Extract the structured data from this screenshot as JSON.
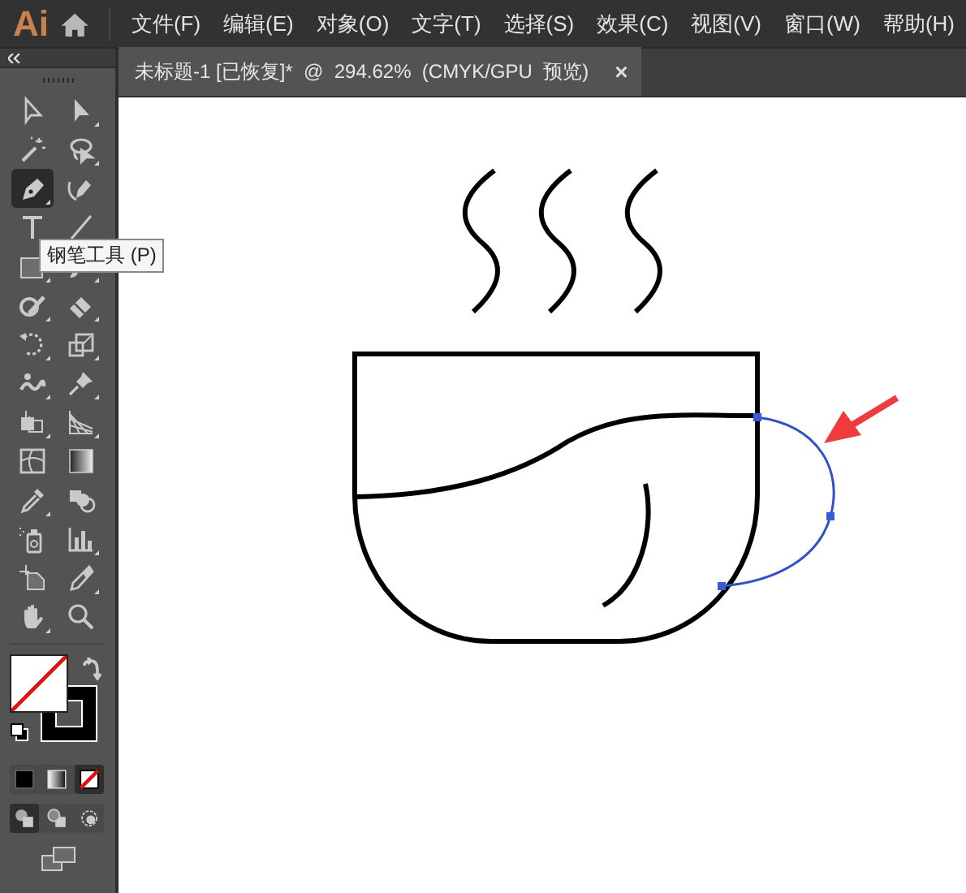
{
  "app": {
    "logo": "Ai"
  },
  "menu": [
    {
      "label": "文件(F)"
    },
    {
      "label": "编辑(E)"
    },
    {
      "label": "对象(O)"
    },
    {
      "label": "文字(T)"
    },
    {
      "label": "选择(S)"
    },
    {
      "label": "效果(C)"
    },
    {
      "label": "视图(V)"
    },
    {
      "label": "窗口(W)"
    },
    {
      "label": "帮助(H)"
    }
  ],
  "document_tab": {
    "title": "未标题-1 [已恢复]*  @  294.62%  (CMYK/GPU  预览)",
    "close": "×"
  },
  "tools": [
    {
      "selected": false,
      "flyout": false
    },
    {
      "selected": false,
      "flyout": true
    },
    {
      "selected": false,
      "flyout": false
    },
    {
      "selected": false,
      "flyout": true
    },
    {
      "selected": true,
      "flyout": true
    },
    {
      "selected": false,
      "flyout": false
    },
    {
      "selected": false
    },
    {
      "selected": false
    },
    {
      "selected": false,
      "flyout": true
    },
    {
      "selected": false,
      "flyout": true
    },
    {
      "selected": false,
      "flyout": true
    },
    {
      "selected": false,
      "flyout": true
    },
    {
      "selected": false,
      "flyout": true
    },
    {
      "selected": false,
      "flyout": true
    },
    {
      "selected": false,
      "flyout": true
    },
    {
      "selected": false,
      "flyout": true
    },
    {
      "selected": false,
      "flyout": true
    },
    {
      "selected": false,
      "flyout": true
    },
    {
      "selected": false,
      "flyout": false
    },
    {
      "selected": false,
      "flyout": false
    },
    {
      "selected": false,
      "flyout": true
    },
    {
      "selected": false,
      "flyout": false
    },
    {
      "selected": false,
      "flyout": false
    },
    {
      "selected": false,
      "flyout": true
    },
    {
      "selected": false,
      "flyout": false
    },
    {
      "selected": false,
      "flyout": true
    },
    {
      "selected": false,
      "flyout": true
    },
    {
      "selected": false,
      "flyout": false
    }
  ],
  "tooltip": "钢笔工具 (P)",
  "color_modes": [
    {
      "selected": false
    },
    {
      "selected": false
    },
    {
      "selected": true
    }
  ],
  "draw_modes": [
    {
      "selected": true
    },
    {
      "selected": false
    },
    {
      "selected": false
    }
  ]
}
